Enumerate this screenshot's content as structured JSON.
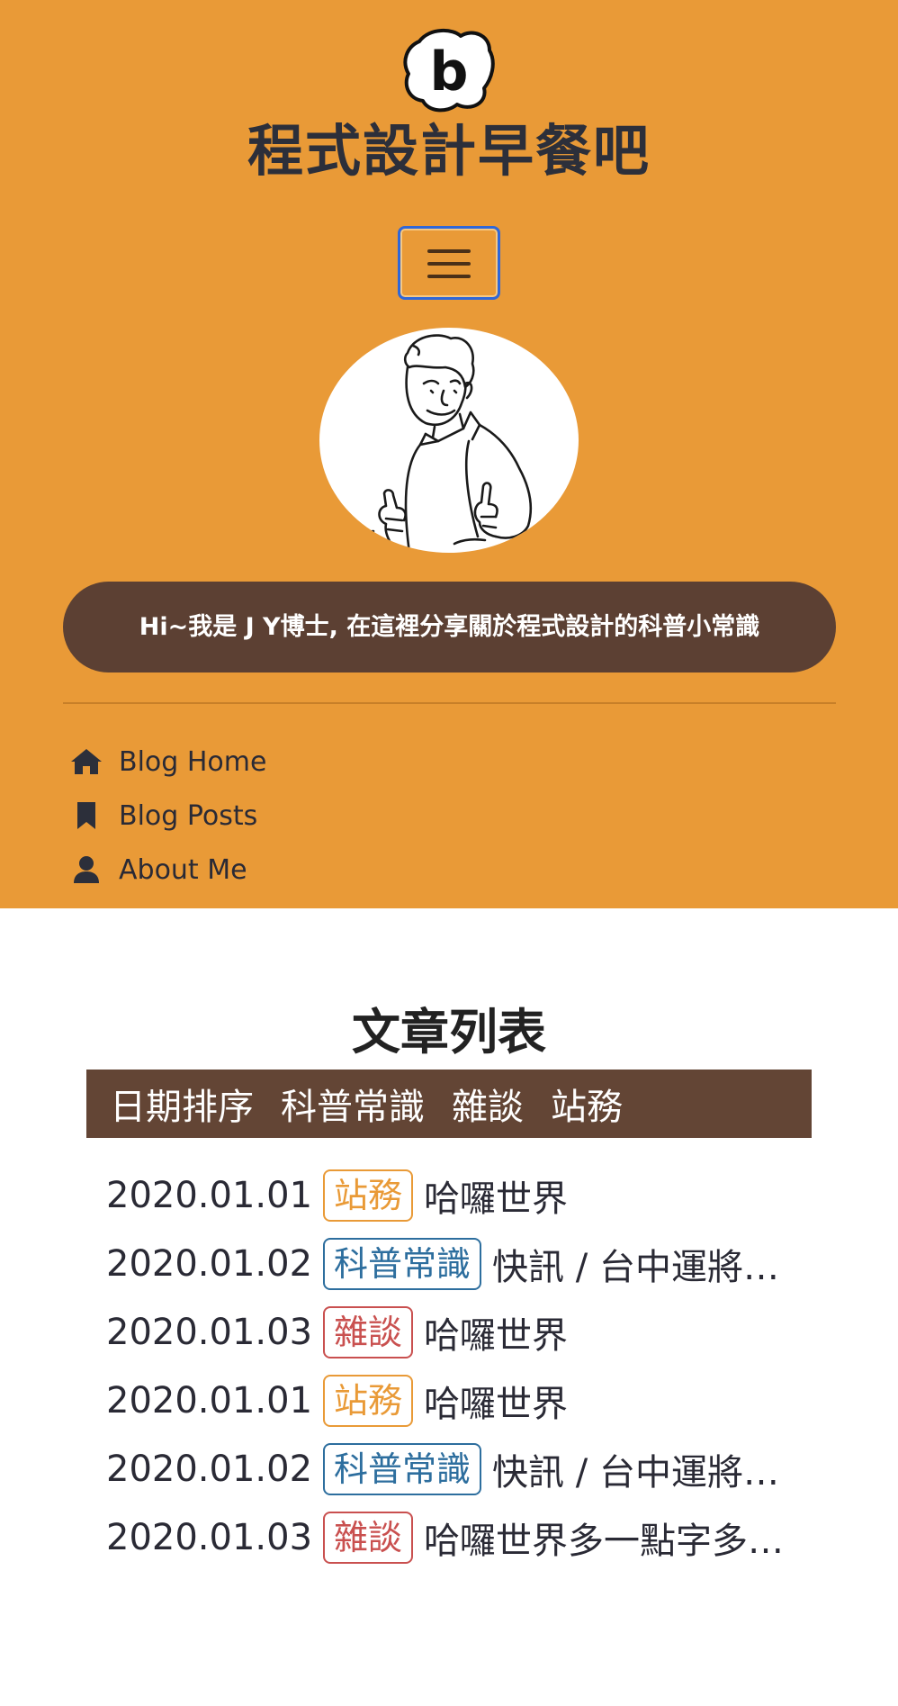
{
  "site": {
    "logo_letter": "b",
    "title": "程式設計早餐吧",
    "menu_icon": "hamburger-icon",
    "intro": "Hi~我是 J Y博士, 在這裡分享關於程式設計的科普小常識"
  },
  "nav": {
    "items": [
      {
        "label": "Blog Home",
        "icon": "home-icon"
      },
      {
        "label": "Blog Posts",
        "icon": "bookmark-icon"
      },
      {
        "label": "About Me",
        "icon": "user-icon"
      }
    ]
  },
  "posts_section": {
    "title": "文章列表",
    "filters": [
      "日期排序",
      "科普常識",
      "雜談",
      "站務"
    ],
    "tag_colors": {
      "站務": "#e99a37",
      "科普常識": "#2d6e9e",
      "雜談": "#c9504f"
    },
    "posts": [
      {
        "date": "2020.01.01",
        "tag": "站務",
        "title": "哈囉世界"
      },
      {
        "date": "2020.01.02",
        "tag": "科普常識",
        "title": "快訊 / 台中運將…"
      },
      {
        "date": "2020.01.03",
        "tag": "雜談",
        "title": "哈囉世界"
      },
      {
        "date": "2020.01.01",
        "tag": "站務",
        "title": "哈囉世界"
      },
      {
        "date": "2020.01.02",
        "tag": "科普常識",
        "title": "快訊 / 台中運將…"
      },
      {
        "date": "2020.01.03",
        "tag": "雜談",
        "title": "哈囉世界多一點字多…"
      }
    ]
  },
  "colors": {
    "header_bg": "#e99a37",
    "dark_brown": "#5c4033",
    "filter_bar_bg": "#634535",
    "text": "#2a2a35"
  }
}
